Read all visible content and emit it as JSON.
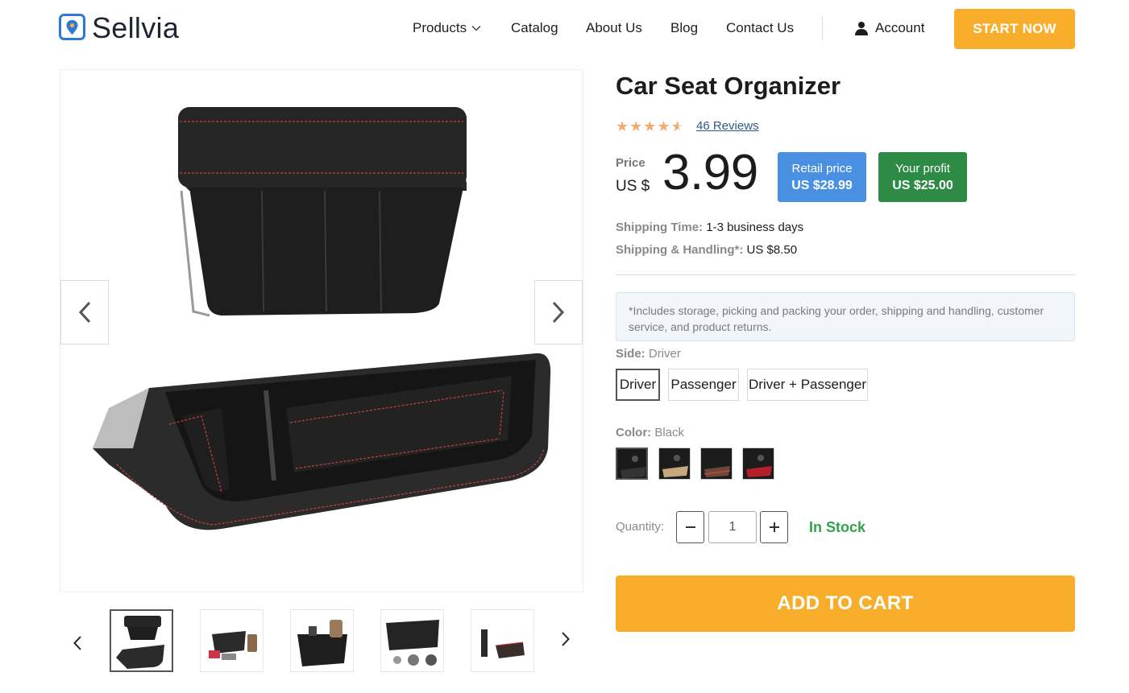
{
  "header": {
    "logo_text": "Sellvia",
    "nav": {
      "products": "Products",
      "catalog": "Catalog",
      "about": "About Us",
      "blog": "Blog",
      "contact": "Contact Us"
    },
    "account": "Account",
    "cta": "START NOW"
  },
  "product": {
    "title": "Car Seat Organizer",
    "rating": 4.5,
    "reviews": "46 Reviews",
    "price_label": "Price",
    "currency": "US $",
    "price": "3.99",
    "retail": {
      "label": "Retail price",
      "value": "US $28.99"
    },
    "profit": {
      "label": "Your profit",
      "value": "US $25.00"
    },
    "shipping_time": {
      "label": "Shipping Time:",
      "value": "1-3 business days"
    },
    "shipping_handling": {
      "label": "Shipping & Handling*:",
      "value": "US $8.50"
    },
    "note": "*Includes storage, picking and packing your order, shipping and handling, customer service, and product returns.",
    "side": {
      "label": "Side:",
      "selected": "Driver",
      "options": [
        "Driver",
        "Passenger",
        "Driver + Passenger"
      ]
    },
    "color": {
      "label": "Color:",
      "selected": "Black"
    },
    "quantity": {
      "label": "Quantity:",
      "value": "1"
    },
    "stock": "In Stock",
    "add_to_cart": "ADD TO CART"
  },
  "colors": {
    "accent": "#f9ae2b",
    "retail_blue": "#4a90e2",
    "profit_green": "#2e8b46",
    "stock_green": "#2fa34a",
    "star": "#f4ab6f"
  }
}
